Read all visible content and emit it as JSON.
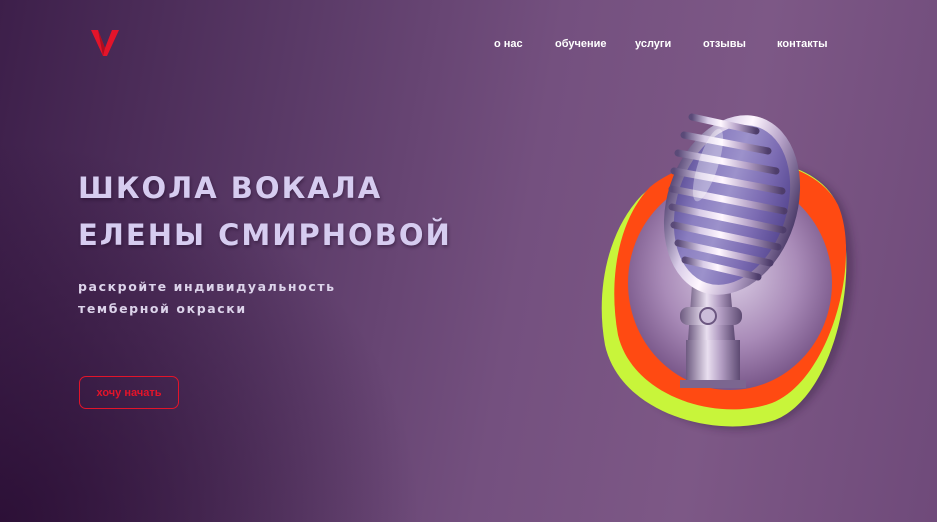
{
  "brand": {
    "logo_icon": "v-logo-icon",
    "logo_color": "#e3142a"
  },
  "nav": {
    "items": [
      {
        "label": "о нас"
      },
      {
        "label": "обучение"
      },
      {
        "label": "услуги"
      },
      {
        "label": "отзывы"
      },
      {
        "label": "контакты"
      }
    ]
  },
  "hero": {
    "title_line1": "ШКОЛА ВОКАЛА",
    "title_line2": "ЕЛЕНЫ СМИРНОВОЙ",
    "subtitle_line1": "раскройте индивидуальность",
    "subtitle_line2": "темберной окраски",
    "cta_label": "хочу начать"
  },
  "illustration": {
    "subject": "microphone-icon",
    "accent_colors": {
      "orange": "#ff4a12",
      "lime": "#c8f53a",
      "cta_red": "#e3142a"
    }
  }
}
